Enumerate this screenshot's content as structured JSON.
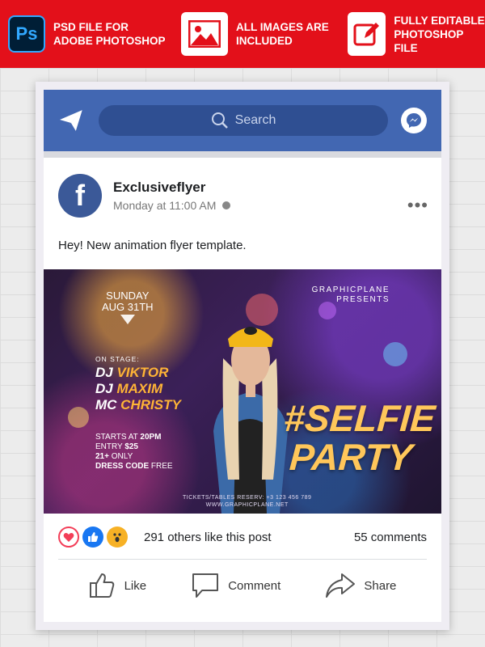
{
  "banner": {
    "features": [
      {
        "icon": "photoshop-icon",
        "badge": "Ps",
        "text": "PSD FILE FOR\nADOBE PHOTOSHOP"
      },
      {
        "icon": "image-icon",
        "text": "ALL IMAGES ARE\nINCLUDED"
      },
      {
        "icon": "edit-icon",
        "text": "FULLY EDITABLE\nPHOTOSHOP FILE"
      }
    ],
    "color": "#e3101a"
  },
  "nav": {
    "search_placeholder": "Search",
    "color": "#4267b2"
  },
  "post": {
    "avatar_letter": "f",
    "author": "Exclusiveflyer",
    "timestamp": "Monday at 11:00 AM",
    "more": "•••",
    "text": "Hey! New animation flyer template."
  },
  "flyer": {
    "date_line1": "SUNDAY",
    "date_line2": "AUG 31TH",
    "presents_line1": "GRAPHICPLANE",
    "presents_line2": "PRESENTS",
    "on_stage": "ON STAGE:",
    "djs": [
      {
        "prefix": "DJ ",
        "name": "VIKTOR"
      },
      {
        "prefix": "DJ ",
        "name": "MAXIM"
      },
      {
        "prefix": "MC ",
        "name": "CHRISTY"
      }
    ],
    "info": [
      {
        "label": "STARTS AT ",
        "value": "20PM"
      },
      {
        "label": "ENTRY ",
        "value": "$25"
      },
      {
        "label": "21+ ",
        "value": "ONLY"
      },
      {
        "label": "DRESS CODE ",
        "value": "FREE"
      }
    ],
    "headline_1": "#SELFIE",
    "headline_2": "PARTY",
    "tickets_line1": "TICKETS/TABLES RESERV: +3 123 456 789",
    "tickets_line2": "WWW.GRAPHICPLANE.NET"
  },
  "engagement": {
    "likes": "291 others like this post",
    "comments": "55 comments"
  },
  "actions": [
    {
      "icon": "like-icon",
      "label": "Like"
    },
    {
      "icon": "comment-icon",
      "label": "Comment"
    },
    {
      "icon": "share-icon",
      "label": "Share"
    }
  ]
}
